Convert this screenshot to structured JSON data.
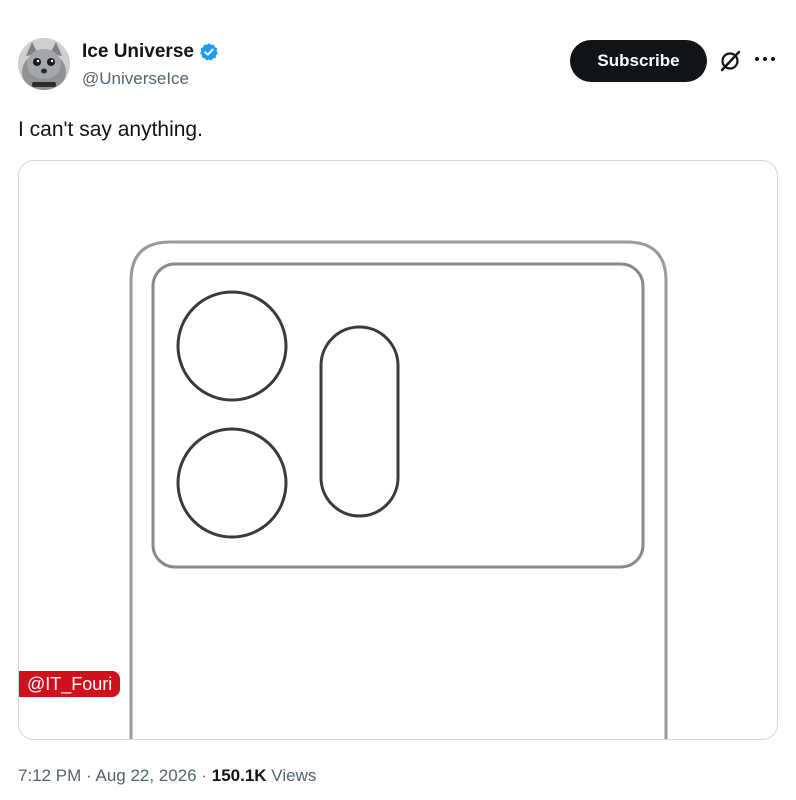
{
  "author": {
    "display_name": "Ice Universe",
    "handle": "@UniverseIce",
    "verified": true,
    "verified_color": "#1d9bf0",
    "avatar_icon": "cat-avatar"
  },
  "actions": {
    "subscribe_label": "Subscribe",
    "grok_icon": "grok-icon",
    "more_icon": "more-icon"
  },
  "tweet": {
    "text": "I can't say anything."
  },
  "media": {
    "watermark": "@IT_Fouri",
    "watermark_color": "#d0111b"
  },
  "meta": {
    "time": "7:12 PM",
    "separator1": " · ",
    "date": "Aug 22, 2026",
    "separator2": " · ",
    "views_count": "150.1K",
    "views_label": " Views"
  }
}
